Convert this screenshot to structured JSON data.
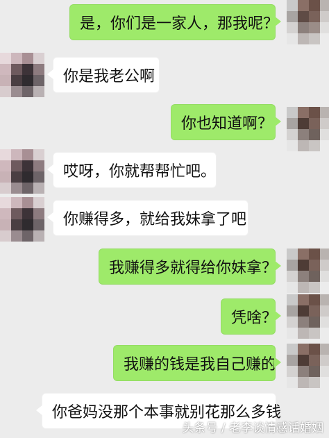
{
  "messages": [
    {
      "side": "out",
      "text": "是，你们是一家人，那我呢？"
    },
    {
      "side": "in",
      "text": "你是我老公啊"
    },
    {
      "side": "out",
      "text": "你也知道啊？"
    },
    {
      "side": "in",
      "text": "哎呀，你就帮帮忙吧。"
    },
    {
      "side": "in",
      "text": "你赚得多，就给我妹拿了吧"
    },
    {
      "side": "out",
      "text": "我赚得多就得给你妹拿？"
    },
    {
      "side": "out",
      "text": "凭啥？"
    },
    {
      "side": "out",
      "text": "我赚的钱是我自己赚的"
    },
    {
      "side": "in",
      "text": "你爸妈没那个本事就别花那么多钱"
    }
  ],
  "watermark": "头条号 / 老李谈情感话婚姻",
  "colors": {
    "background": "#ececec",
    "outgoing_bubble": "#9eea6a",
    "incoming_bubble": "#ffffff"
  }
}
